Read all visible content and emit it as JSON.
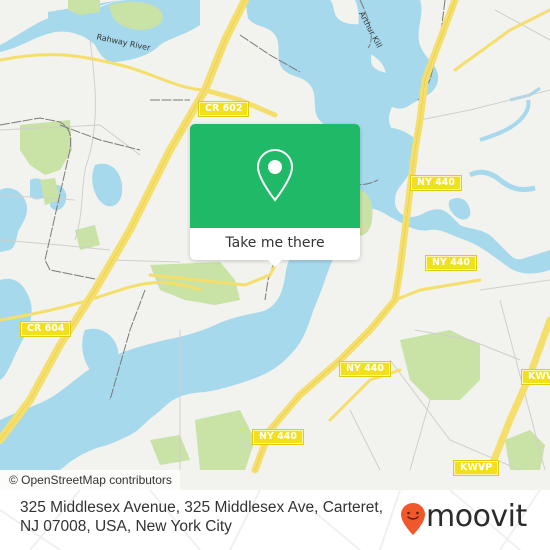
{
  "map": {
    "attribution": "© OpenStreetMap contributors",
    "water_labels": [
      {
        "name": "rahway-river",
        "text": "Rahway River"
      },
      {
        "name": "arthur-kill",
        "text": "Arthur Kill"
      }
    ],
    "road_shields": [
      {
        "id": "cr-602",
        "text": "CR 602"
      },
      {
        "id": "cr-604",
        "text": "CR 604"
      },
      {
        "id": "ny-440-a",
        "text": "NY 440"
      },
      {
        "id": "ny-440-b",
        "text": "NY 440"
      },
      {
        "id": "ny-440-c",
        "text": "NY 440"
      },
      {
        "id": "ny-440-d",
        "text": "NY 440"
      },
      {
        "id": "ny-440-e",
        "text": "NY 440"
      },
      {
        "id": "kwvp-a",
        "text": "KWVP"
      },
      {
        "id": "kwvp-b",
        "text": "KWVP"
      }
    ],
    "colors": {
      "land": "#f2f2ee",
      "water": "#a7d9ec",
      "park": "#c9e2a6",
      "highway": "#f5df6c",
      "shield": "#f3e01c"
    }
  },
  "popup": {
    "icon": "location-pin-icon",
    "button_label": "Take me there",
    "color": "#1fb968"
  },
  "footer": {
    "address": "325 Middlesex Avenue, 325 Middlesex Ave, Carteret, NJ 07008, USA, New York City",
    "brand": "moovit",
    "brand_color": "#f0582b"
  }
}
